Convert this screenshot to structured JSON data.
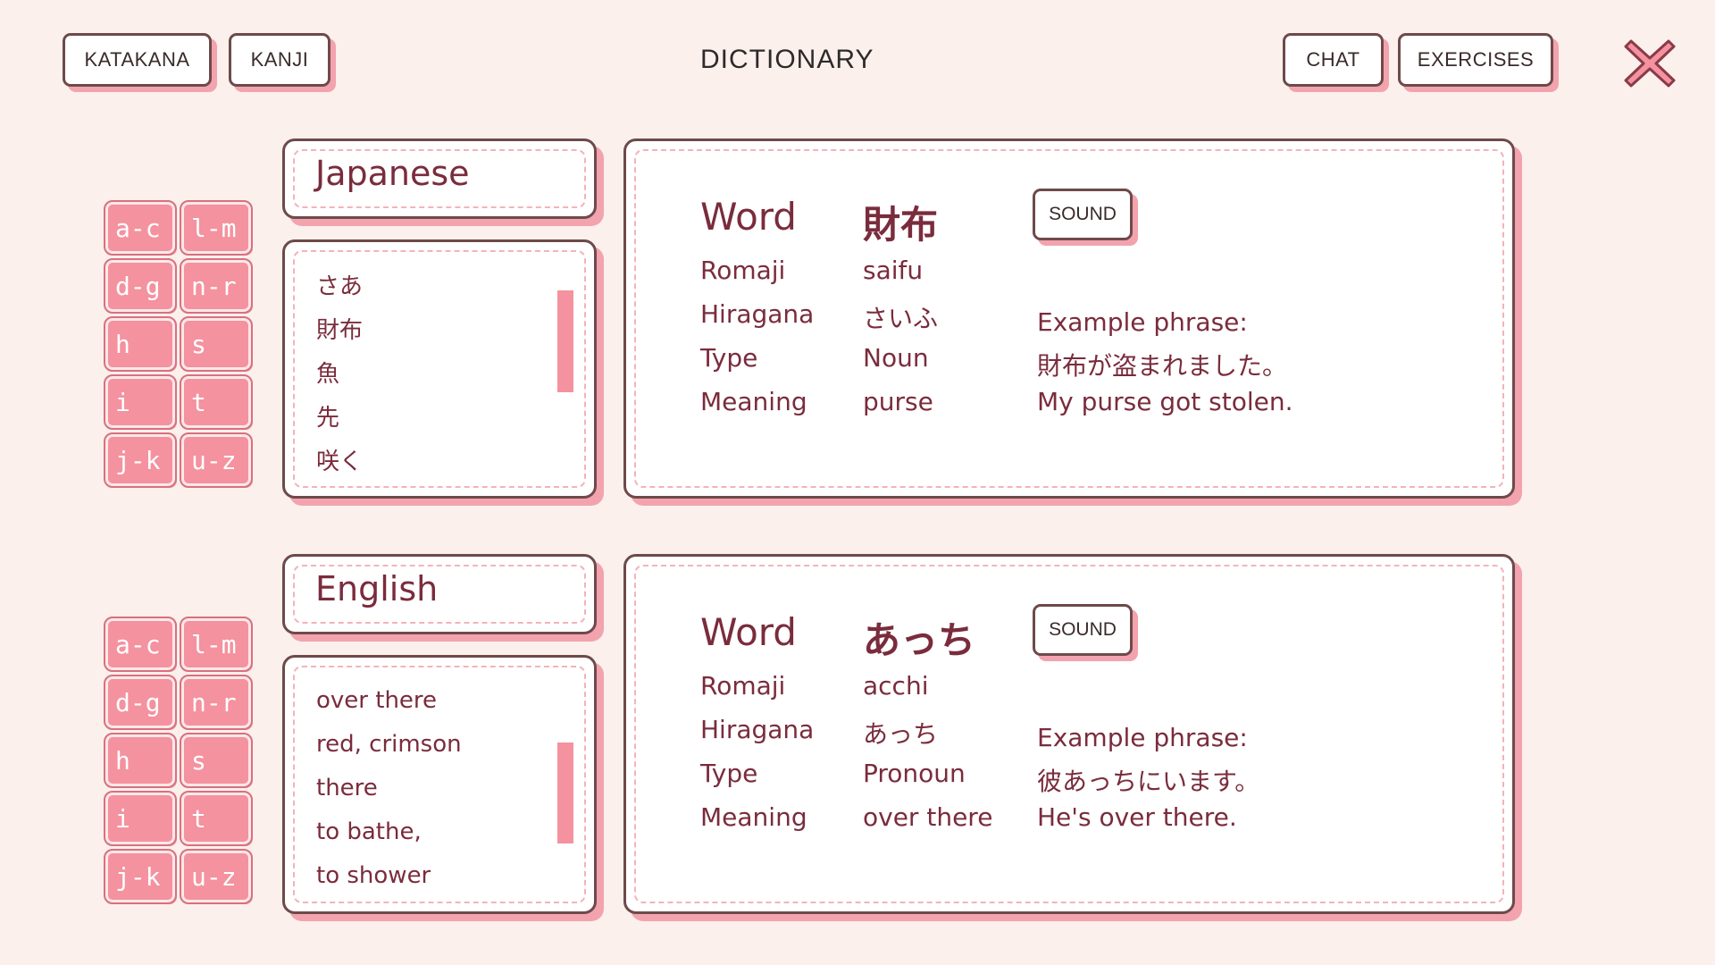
{
  "header": {
    "katakana_label": "KATAKANA",
    "kanji_label": "KANJI",
    "title": "DICTIONARY",
    "chat_label": "CHAT",
    "exercises_label": "EXERCISES"
  },
  "letter_groups": [
    "a-c",
    "l-m",
    "d-g",
    "n-r",
    "h",
    "s",
    "i",
    "t",
    "j-k",
    "u-z"
  ],
  "japanese": {
    "title": "Japanese",
    "items": [
      "さあ",
      "財布",
      "魚",
      "先",
      "咲く"
    ],
    "detail": {
      "word_label": "Word",
      "word": "財布",
      "romaji_label": "Romaji",
      "romaji": "saifu",
      "hiragana_label": "Hiragana",
      "hiragana": "さいふ",
      "type_label": "Type",
      "type": "Noun",
      "meaning_label": "Meaning",
      "meaning": "purse",
      "sound_label": "SOUND",
      "example_label": "Example phrase:",
      "example_jp": "財布が盗まれました。",
      "example_en": "My purse got stolen."
    }
  },
  "english": {
    "title": "English",
    "items": [
      "over there",
      "red, crimson",
      "there",
      "to bathe,",
      "to shower"
    ],
    "detail": {
      "word_label": "Word",
      "word": "あっち",
      "romaji_label": "Romaji",
      "romaji": "acchi",
      "hiragana_label": "Hiragana",
      "hiragana": "あっち",
      "type_label": "Type",
      "type": "Pronoun",
      "meaning_label": "Meaning",
      "meaning": "over there",
      "sound_label": "SOUND",
      "example_label": "Example phrase:",
      "example_jp": "彼あっちにいます。",
      "example_en": "He's over there."
    }
  },
  "colors": {
    "background": "#fbf0ec",
    "accent_pink": "#f4929f",
    "text_maroon": "#7a2c3c",
    "border_brown": "#6e4a4a"
  }
}
